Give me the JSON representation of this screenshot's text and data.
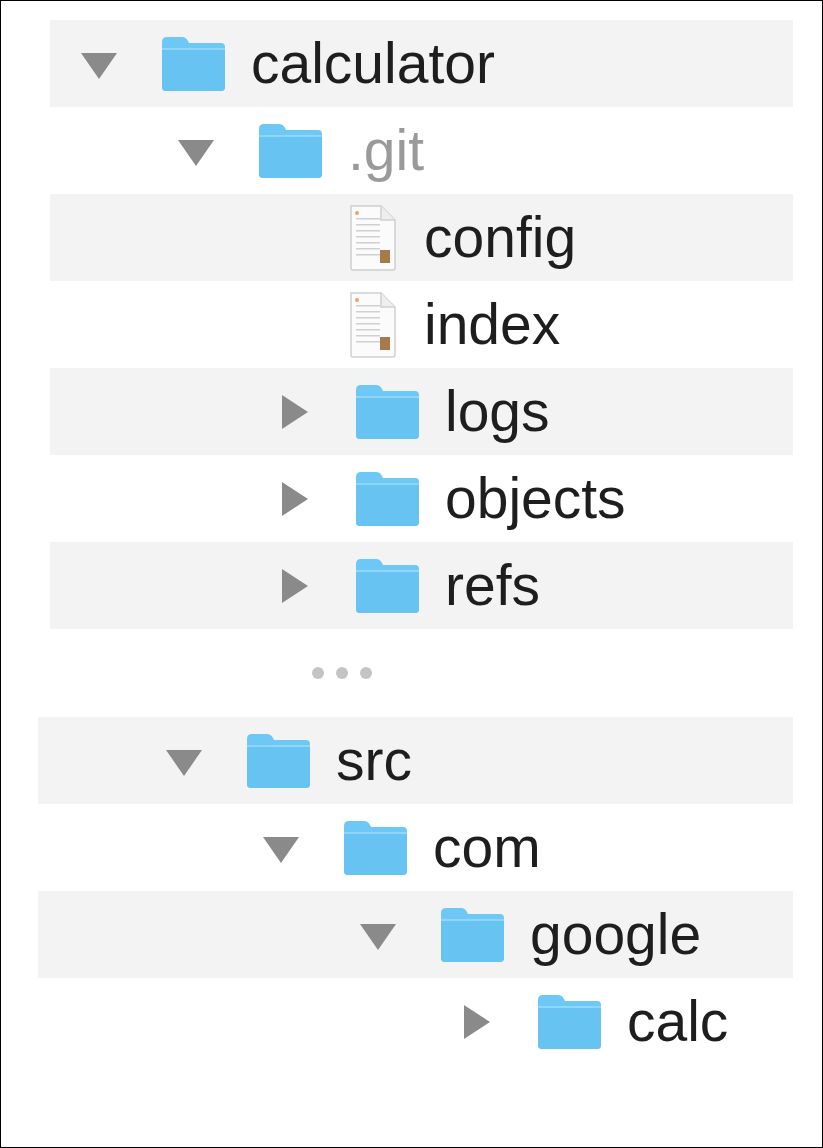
{
  "tree": [
    {
      "kind": "folder",
      "name": "calculator",
      "expanded": true,
      "dimmed": false,
      "children": [
        {
          "kind": "folder",
          "name": ".git",
          "expanded": true,
          "dimmed": true,
          "children": [
            {
              "kind": "file",
              "name": "config",
              "dimmed": false
            },
            {
              "kind": "file",
              "name": "index",
              "dimmed": false
            },
            {
              "kind": "folder",
              "name": "logs",
              "expanded": false,
              "dimmed": false
            },
            {
              "kind": "folder",
              "name": "objects",
              "expanded": false,
              "dimmed": false
            },
            {
              "kind": "folder",
              "name": "refs",
              "expanded": false,
              "dimmed": false
            }
          ]
        }
      ]
    }
  ],
  "tree_continued": [
    {
      "kind": "folder",
      "name": "src",
      "expanded": true,
      "dimmed": false,
      "children": [
        {
          "kind": "folder",
          "name": "com",
          "expanded": true,
          "dimmed": false,
          "children": [
            {
              "kind": "folder",
              "name": "google",
              "expanded": true,
              "dimmed": false,
              "children": [
                {
                  "kind": "folder",
                  "name": "calc",
                  "expanded": false,
                  "dimmed": false
                }
              ]
            }
          ]
        }
      ]
    }
  ]
}
